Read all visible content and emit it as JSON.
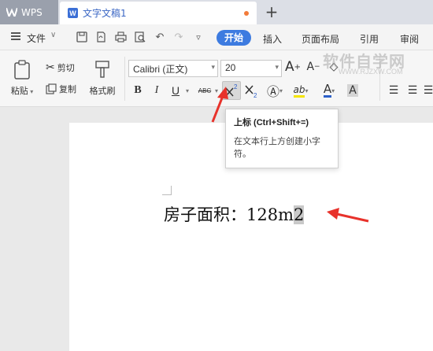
{
  "titlebar": {
    "app_name": "WPS",
    "document_tab": "文字文稿1",
    "new_tab": "+"
  },
  "menubar": {
    "file": "文件",
    "tabs": [
      "开始",
      "插入",
      "页面布局",
      "引用",
      "审阅"
    ]
  },
  "ribbon": {
    "paste": "粘贴",
    "cut": "剪切",
    "copy": "复制",
    "format_painter": "格式刷",
    "font_name": "Calibri (正文)",
    "font_size": "20",
    "bold": "B",
    "italic": "I",
    "underline": "U",
    "strike": "ABC",
    "font_color": "A",
    "highlight": "ab",
    "char_shade": "A"
  },
  "tooltip": {
    "title": "上标 (Ctrl+Shift+=)",
    "description": "在文本行上方创建小字符。"
  },
  "document": {
    "text": "房子面积：128m",
    "selected_char": "2"
  },
  "watermark": {
    "text": "软件自学网",
    "sub": "WWW.RJZXW.COM"
  },
  "colors": {
    "accent": "#3d7be0",
    "annotation": "#e8322b",
    "tab_dot": "#f27b3a"
  }
}
